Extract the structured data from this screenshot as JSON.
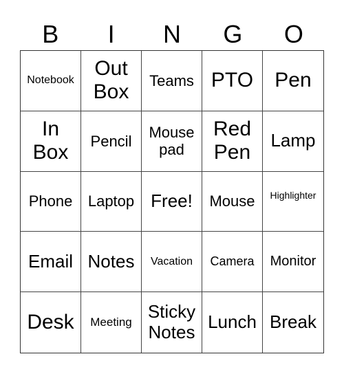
{
  "header": [
    "B",
    "I",
    "N",
    "G",
    "O"
  ],
  "cells": [
    [
      "Notebook",
      "Out Box",
      "Teams",
      "PTO",
      "Pen"
    ],
    [
      "In Box",
      "Pencil",
      "Mouse pad",
      "Red Pen",
      "Lamp"
    ],
    [
      "Phone",
      "Laptop",
      "Free!",
      "Mouse",
      "Highlighter"
    ],
    [
      "Email",
      "Notes",
      "Vacation",
      "Camera",
      "Monitor"
    ],
    [
      "Desk",
      "Meeting",
      "Sticky Notes",
      "Lunch",
      "Break"
    ]
  ]
}
